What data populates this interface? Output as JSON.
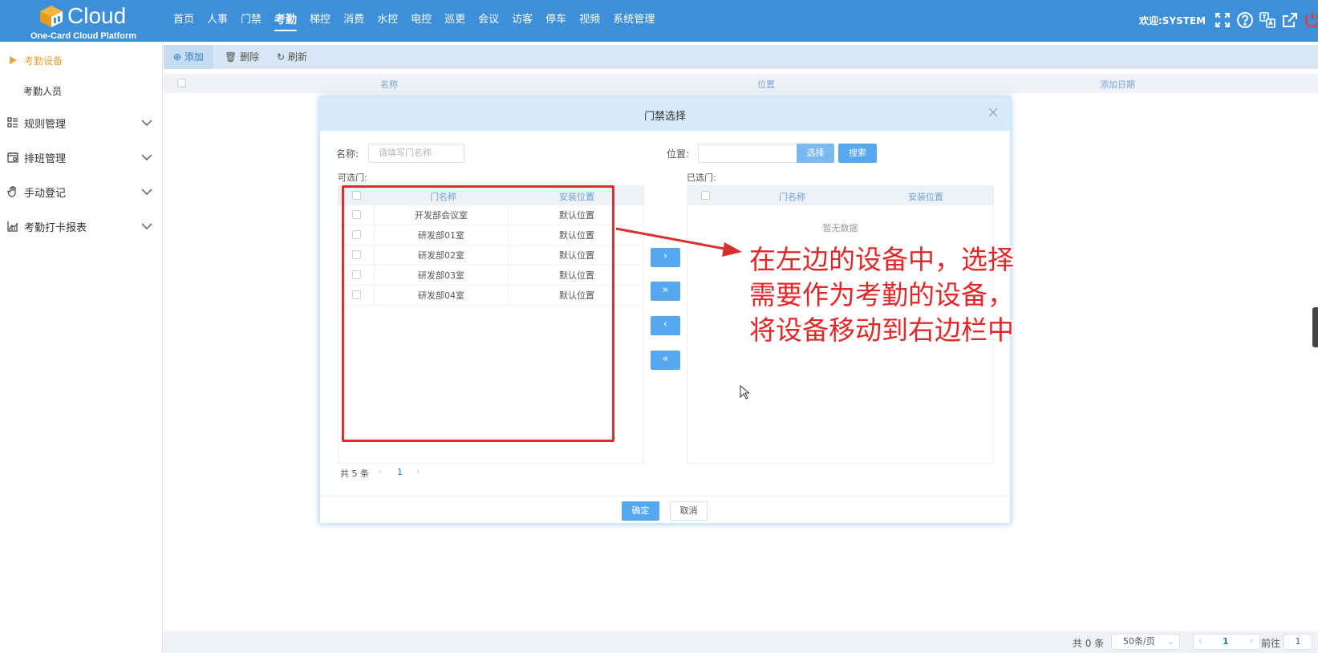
{
  "topbar": {
    "logo_text": "Cloud",
    "logo_sub": "One-Card Cloud Platform",
    "nav": [
      "首页",
      "人事",
      "门禁",
      "考勤",
      "梯控",
      "消费",
      "水控",
      "电控",
      "巡更",
      "会议",
      "访客",
      "停车",
      "视频",
      "系统管理"
    ],
    "active_nav": "考勤",
    "welcome": "欢迎:SYSTEM",
    "icons": [
      "fullscreen-icon",
      "help-icon",
      "translate-icon",
      "external-link-icon",
      "power-icon"
    ]
  },
  "sidebar": {
    "items": [
      {
        "label": "考勤设备",
        "active": true
      },
      {
        "label": "考勤人员"
      },
      {
        "label": "规则管理",
        "icon": "list-icon"
      },
      {
        "label": "排班管理",
        "icon": "calendar-icon"
      },
      {
        "label": "手动登记",
        "icon": "hand-icon"
      },
      {
        "label": "考勤打卡报表",
        "icon": "chart-icon"
      }
    ]
  },
  "toolbar": {
    "add": "添加",
    "delete": "删除",
    "refresh": "刷新"
  },
  "main_table": {
    "columns": [
      "名称",
      "位置",
      "添加日期"
    ]
  },
  "footer": {
    "total": "共 0 条",
    "page_size": "50条/页",
    "page": "1",
    "goto_label": "前往",
    "goto_value": "1"
  },
  "modal": {
    "title": "门禁选择",
    "name_label": "名称:",
    "name_placeholder": "请填写门名称",
    "location_label": "位置:",
    "select_btn": "选择",
    "search_btn": "搜索",
    "available_label": "可选门:",
    "selected_label": "已选门:",
    "columns": [
      "门名称",
      "安装位置"
    ],
    "rows": [
      {
        "name": "开发部会议室",
        "location": "默认位置"
      },
      {
        "name": "研发部01室",
        "location": "默认位置"
      },
      {
        "name": "研发部02室",
        "location": "默认位置"
      },
      {
        "name": "研发部03室",
        "location": "默认位置"
      },
      {
        "name": "研发部04室",
        "location": "默认位置"
      }
    ],
    "no_data": "暂无数据",
    "total": "共 5 条",
    "page": "1",
    "move_buttons": [
      "›",
      "»",
      "‹",
      "«"
    ],
    "ok": "确定",
    "cancel": "取消"
  },
  "annotation": {
    "lines": [
      "在左边的设备中，选择",
      "需要作为考勤的设备，",
      "将设备移动到右边栏中"
    ],
    "color": "#e0282a"
  }
}
